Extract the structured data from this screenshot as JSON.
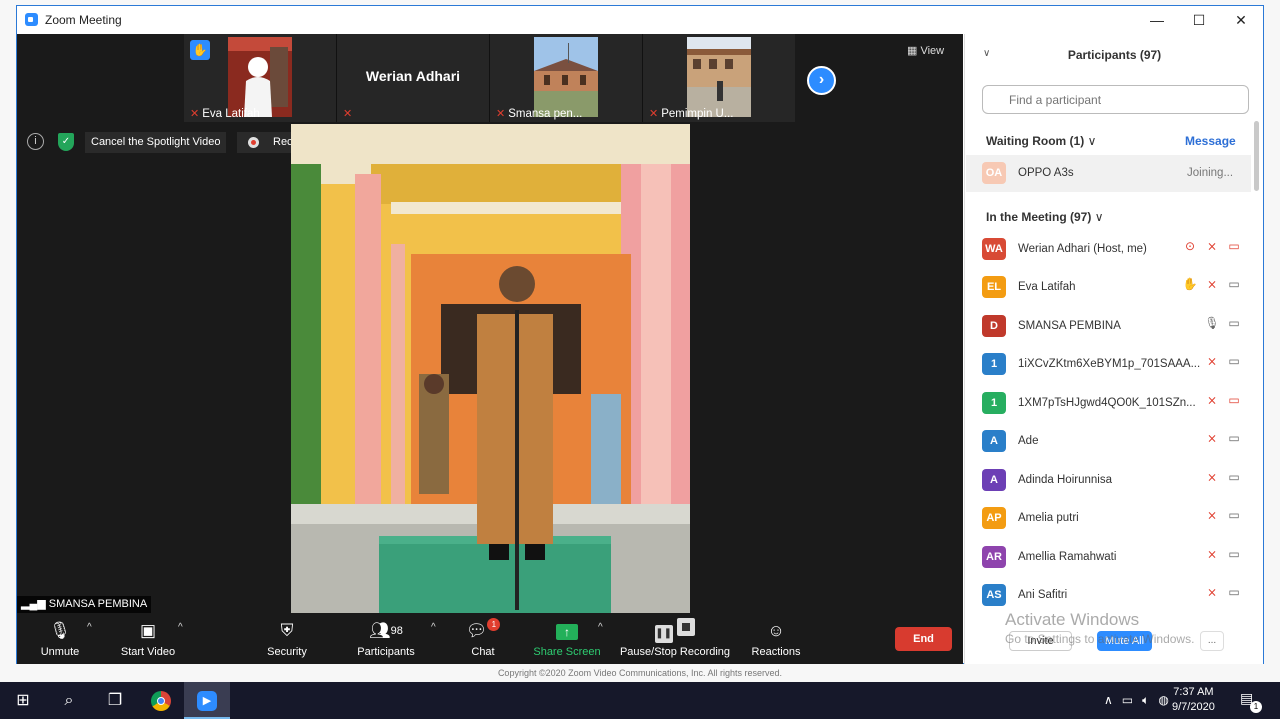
{
  "window": {
    "title": "Zoom Meeting",
    "minimize": "—",
    "maximize": "☐",
    "close": "✕"
  },
  "view_label": "View",
  "strip": {
    "tiles": [
      {
        "name": "Eva Latifah"
      },
      {
        "name": "Werian Adhari"
      },
      {
        "name": "Smansa pen..."
      },
      {
        "name": "Pemimpin U..."
      }
    ]
  },
  "spotlight": {
    "cancel_label": "Cancel the Spotlight Video"
  },
  "recording": {
    "label": "Recording..."
  },
  "active_speaker": "SMANSA PEMBINA",
  "toolbar": {
    "unmute": "Unmute",
    "start_video": "Start Video",
    "security": "Security",
    "participants": "Participants",
    "participants_count": "98",
    "chat": "Chat",
    "chat_badge": "1",
    "share_screen": "Share Screen",
    "pause_stop": "Pause/Stop Recording",
    "reactions": "Reactions",
    "end": "End"
  },
  "panel": {
    "title": "Participants (97)",
    "search_placeholder": "Find a participant",
    "waiting_header": "Waiting Room (1)",
    "message_label": "Message",
    "waiting": {
      "initials": "OA",
      "name": "OPPO A3s",
      "status": "Joining...",
      "color": "#f7c9b4"
    },
    "meeting_header": "In the Meeting (97)",
    "participants": [
      {
        "initials": "WA",
        "name": "Werian Adhari (Host, me)",
        "color": "#d84a35"
      },
      {
        "initials": "EL",
        "name": "Eva Latifah",
        "color": "#f39c12"
      },
      {
        "initials": "D",
        "name": "SMANSA PEMBINA",
        "color": "#c0392b"
      },
      {
        "initials": "1",
        "name": "1iXCvZKtm6XeBYM1p_701SAAA...",
        "color": "#2a7fc9"
      },
      {
        "initials": "1",
        "name": "1XM7pTsHJgwd4QO0K_101SZn...",
        "color": "#27ae60"
      },
      {
        "initials": "A",
        "name": "Ade",
        "color": "#2a7fc9"
      },
      {
        "initials": "A",
        "name": "Adinda Hoirunnisa",
        "color": "#6c3fb5"
      },
      {
        "initials": "AP",
        "name": "Amelia putri",
        "color": "#f39c12"
      },
      {
        "initials": "AR",
        "name": "Amellia Ramahwati",
        "color": "#8e44ad"
      },
      {
        "initials": "AS",
        "name": "Ani Safitri",
        "color": "#2a7fc9"
      }
    ],
    "invite": "Invite",
    "mute_all": "Mute All",
    "more": "..."
  },
  "activate_windows": {
    "line1": "Activate Windows",
    "line2": "Go to Settings to activate Windows."
  },
  "copyright": "Copyright ©2020 Zoom Video Communications, Inc. All rights reserved.",
  "taskbar": {
    "time": "7:37 AM",
    "date": "9/7/2020",
    "notification_count": "1"
  }
}
